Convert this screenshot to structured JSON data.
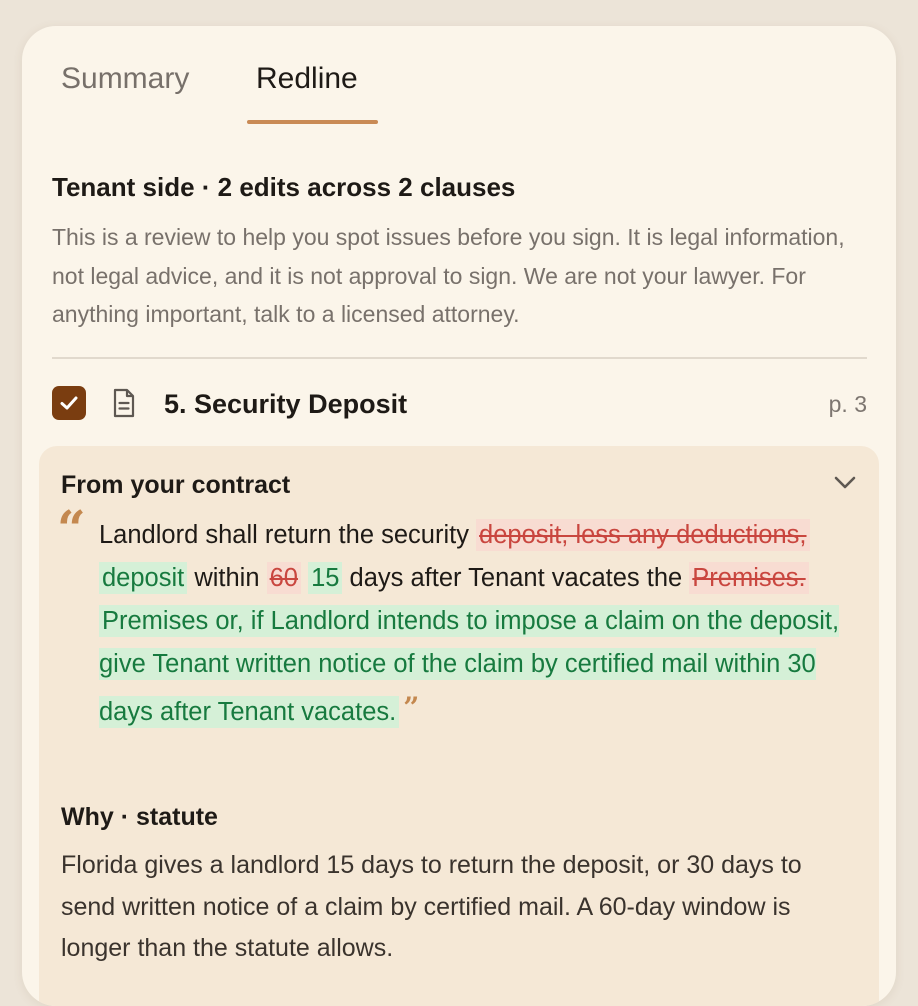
{
  "tabs": {
    "summary": "Summary",
    "redline": "Redline",
    "active": "Redline"
  },
  "heading": "Tenant side · 2 edits across 2 clauses",
  "disclaimer": "This is a review to help you spot issues before you sign. It is legal information, not legal advice, and it is not approval to sign. We are not your lawyer. For anything important, talk to a licensed attorney.",
  "clause": {
    "checked": true,
    "title": "5. Security Deposit",
    "page": "p. 3",
    "panel_header": "From your contract",
    "quote": {
      "t1": "Landlord shall return the security ",
      "del1": "deposit, less any deductions,",
      "ins1": "deposit",
      "t2": " within ",
      "del2": "60",
      "ins2": "15",
      "t3": " days after Tenant vacates the ",
      "del3": "Premises.",
      "ins3": "Premises or, if Landlord intends to impose a claim on the deposit, give Tenant written notice of the claim by certified mail within 30 days after Tenant vacates."
    },
    "why_heading": "Why · statute",
    "why_body": "Florida gives a landlord 15 days to return the deposit, or 30 days to send written notice of a claim by certified mail. A 60-day window is longer than the statute allows."
  },
  "colors": {
    "accent": "#c98a55",
    "checkbox": "#7a3d10",
    "deleted_text": "#c9463f",
    "deleted_bg": "#f8dcd2",
    "inserted_text": "#177a3f",
    "inserted_bg": "#d5f0d7"
  },
  "icons": {
    "checkbox": "check-icon",
    "clause": "document-icon",
    "collapse": "chevron-down-icon",
    "quote": "quote-mark-icon"
  }
}
